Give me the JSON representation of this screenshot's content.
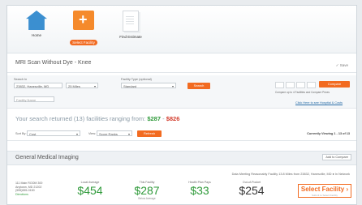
{
  "steps": [
    {
      "label": "Home",
      "icon": "home-icon"
    },
    {
      "label": "Select Facility",
      "icon": "add-folder-icon"
    },
    {
      "label": "Find Estimate",
      "icon": "document-icon"
    }
  ],
  "page_title": "MRI Scan Without Dye - Knee",
  "save_label": "✓ Save",
  "search": {
    "search_in_label": "Search In",
    "location_value": "23832, Hanesville, MD",
    "radius_value": "25 Miles",
    "facility_type_label": "Facility Type (optional)",
    "facility_type_value": "Standard",
    "search_button": "Search",
    "facility_name_placeholder": "Facility Name",
    "compare_button": "Compare",
    "compare_hint": "Compare up to 4 Facilities and Compare Prices",
    "hospital_link": "Click Here to see Hospital & Costs"
  },
  "results": {
    "prefix": "Your search returned (13) facilities ranging from:",
    "low_price": "$287",
    "dash": "-",
    "high_price": "$826"
  },
  "sort": {
    "sort_by_label": "Sort By:",
    "sort_value": "Cost",
    "view_label": "View:",
    "view_value": "Score Ranks",
    "refresh_button": "Refresh",
    "showing_text": "Currently Viewing 1 - 13 of 13"
  },
  "section": {
    "title": "General Medical Imaging",
    "add_compare": "Add to Compare"
  },
  "infobar": "Data Meeting Reasonably Facility   13.8 Miles from 23832, Hanesville, MD  ● In Network",
  "facility": {
    "address_lines": [
      "111 Main ROOM 300",
      "Anytown, MD 21202",
      "(555)555-0150"
    ],
    "open_status": "Directions",
    "columns": [
      {
        "label": "Local Average",
        "value": "$454",
        "sub": ""
      },
      {
        "label": "This Facility",
        "value": "$287",
        "sub": "Below Average"
      },
      {
        "label": "Health Plan Pays",
        "value": "$33",
        "sub": ""
      },
      {
        "label": "Out-of-Pocket",
        "value": "$254",
        "sub": ""
      }
    ],
    "select_button": "Select Facility ›",
    "select_sub": "Submit to Select Facility"
  },
  "colors": {
    "accent": "#f26b21",
    "price_green": "#2f9a3a",
    "price_red": "#d23a2a",
    "link": "#2a6ea8"
  }
}
